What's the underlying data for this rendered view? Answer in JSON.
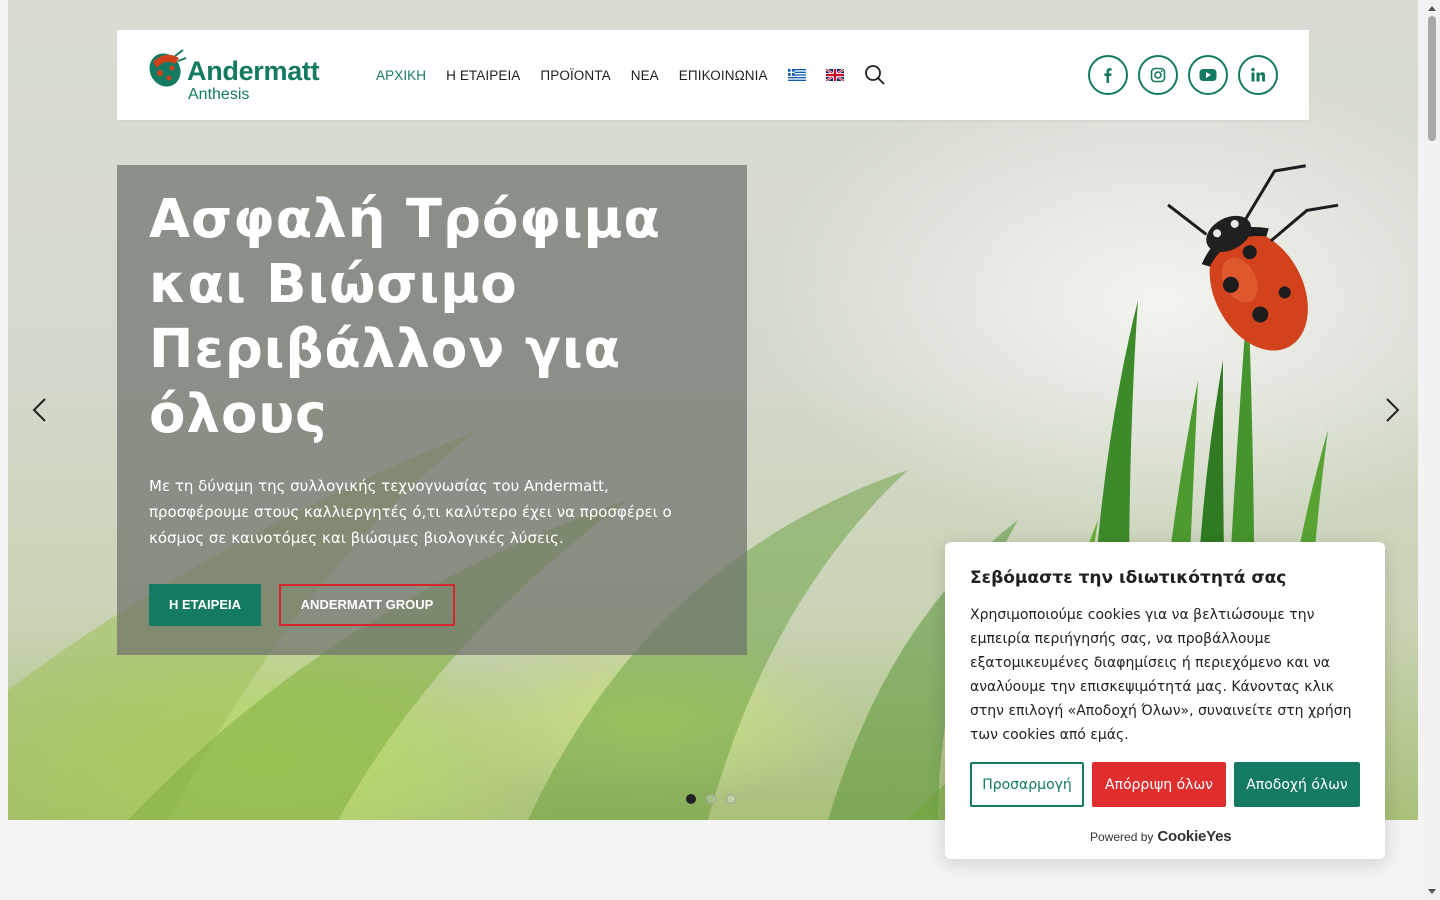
{
  "header": {
    "logo": {
      "name": "Andermatt",
      "sub": "Anthesis"
    },
    "nav": [
      {
        "label": "ΑΡΧΙΚΗ",
        "active": true
      },
      {
        "label": "Η ΕΤΑΙΡΕΙΑ",
        "active": false
      },
      {
        "label": "ΠΡΟΪΟΝΤΑ",
        "active": false
      },
      {
        "label": "ΝΕΑ",
        "active": false
      },
      {
        "label": "ΕΠΙΚΟΙΝΩΝΙΑ",
        "active": false
      }
    ],
    "languages": [
      "greek-flag-icon",
      "uk-flag-icon"
    ],
    "socials": [
      "facebook-icon",
      "instagram-icon",
      "youtube-icon",
      "linkedin-icon"
    ]
  },
  "hero": {
    "title": "Ασφαλή Τρόφιμα και Βιώσιμο Περιβάλλον για όλους",
    "text": "Με τη δύναμη της συλλογικής τεχνογνωσίας του Andermatt, προσφέρουμε στους καλλιεργητές ό,τι καλύτερο έχει να προσφέρει ο κόσμος σε καινοτόμες και βιώσιμες βιολογικές λύσεις.",
    "buttons": {
      "company": "Η ΕΤΑΙΡΕΙΑ",
      "group": "ANDERMATT GROUP"
    },
    "slides": {
      "count": 3,
      "active": 1
    }
  },
  "cookie": {
    "title": "Σεβόμαστε την ιδιωτικότητά σας",
    "text": "Χρησιμοποιούμε cookies για να βελτιώσουμε την εμπειρία περιήγησής σας, να προβάλλουμε εξατομικευμένες διαφημίσεις ή περιεχόμενο και να αναλύουμε την επισκεψιμότητά μας. Κάνοντας κλικ στην επιλογή «Αποδοχή Όλων», συναινείτε στη χρήση των cookies από εμάς.",
    "buttons": {
      "customize": "Προσαρμογή",
      "reject": "Απόρριψη όλων",
      "accept": "Αποδοχή όλων"
    },
    "powered_label": "Powered by",
    "powered_brand": "CookieYes"
  },
  "colors": {
    "brand_green": "#147a61",
    "accent_red": "#d6262b",
    "reject_red": "#e02e2e"
  }
}
